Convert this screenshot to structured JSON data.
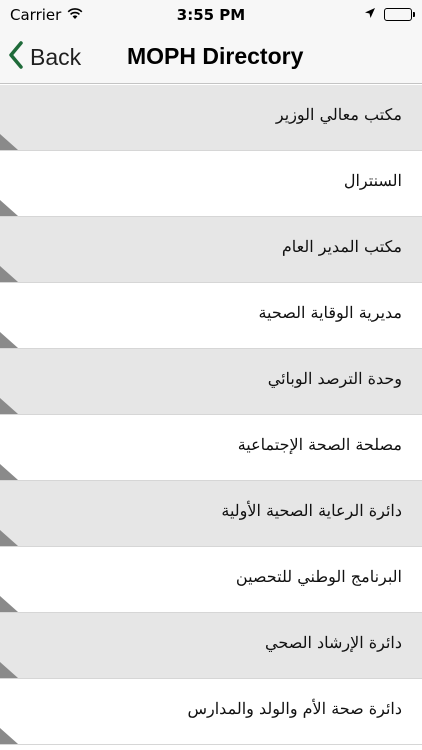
{
  "status_bar": {
    "carrier": "Carrier",
    "time": "3:55 PM",
    "icons": [
      "wifi-icon",
      "location-arrow-icon",
      "battery-icon"
    ]
  },
  "nav": {
    "back_label": "Back",
    "title": "MOPH Directory",
    "accent_color": "#1f6b3a"
  },
  "list": {
    "items": [
      {
        "label": "مكتب معالي الوزير"
      },
      {
        "label": "السنترال"
      },
      {
        "label": "مكتب المدير العام"
      },
      {
        "label": "مديرية الوقاية الصحية"
      },
      {
        "label": "وحدة الترصد الوبائي"
      },
      {
        "label": "مصلحة الصحة الإجتماعية"
      },
      {
        "label": "دائرة الرعاية الصحية الأولية"
      },
      {
        "label": "البرنامج الوطني للتحصين"
      },
      {
        "label": "دائرة الإرشاد الصحي"
      },
      {
        "label": "دائرة صحة الأم والولد والمدارس"
      }
    ]
  },
  "colors": {
    "row_shaded": "#e6e6e6",
    "row_plain": "#ffffff",
    "corner_marker": "#8a8a8a"
  }
}
